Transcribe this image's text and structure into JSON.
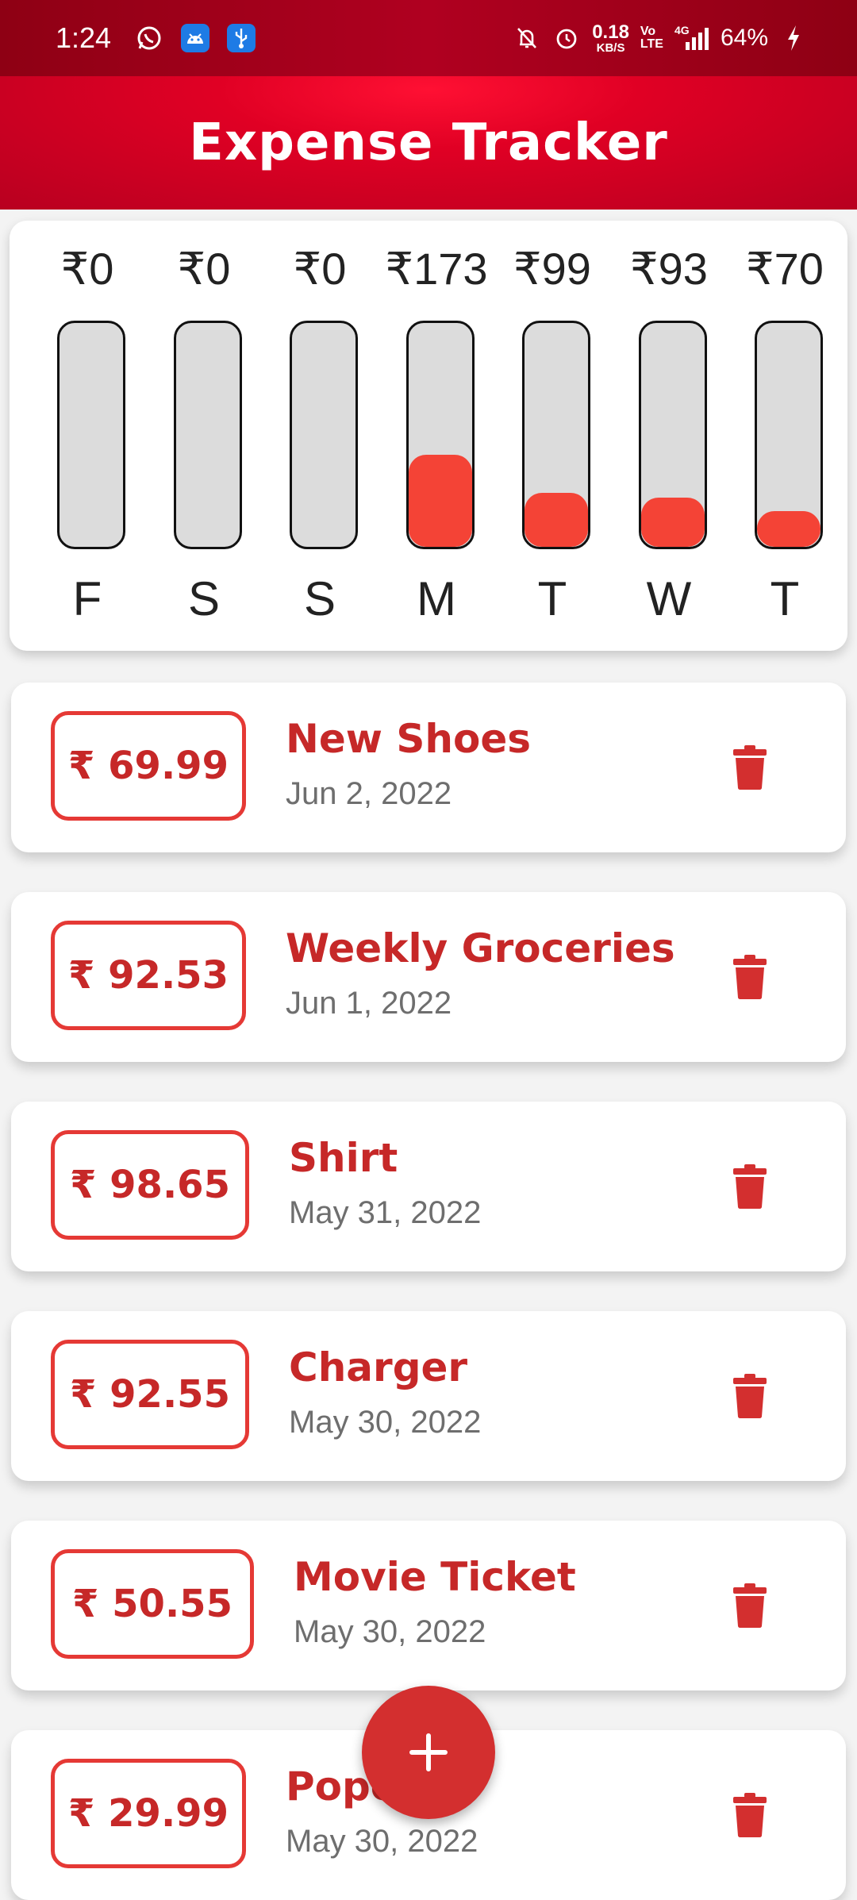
{
  "status_bar": {
    "time": "1:24",
    "net_speed_value": "0.18",
    "net_speed_unit": "KB/S",
    "volte_top": "Vo",
    "volte_bottom": "LTE",
    "network": "4G",
    "battery": "64%",
    "icons": [
      "whatsapp-icon",
      "android-icon",
      "usb-icon",
      "mute-icon",
      "alarm-icon",
      "signal-icon",
      "charging-icon"
    ]
  },
  "app_bar": {
    "title": "Expense Tracker"
  },
  "chart_data": {
    "type": "bar",
    "categories": [
      "F",
      "S",
      "S",
      "M",
      "T",
      "W",
      "T"
    ],
    "labels": [
      "₹0",
      "₹0",
      "₹0",
      "₹173",
      "₹99",
      "₹93",
      "₹70"
    ],
    "values": [
      0,
      0,
      0,
      173,
      99,
      93,
      70
    ],
    "fill_fraction": [
      0,
      0,
      0,
      0.41,
      0.24,
      0.22,
      0.16
    ]
  },
  "transactions": [
    {
      "amount": "₹ 69.99",
      "title": "New Shoes",
      "date": "Jun 2, 2022"
    },
    {
      "amount": "₹ 92.53",
      "title": "Weekly Groceries",
      "date": "Jun 1, 2022"
    },
    {
      "amount": "₹ 98.65",
      "title": "Shirt",
      "date": "May 31, 2022"
    },
    {
      "amount": "₹ 92.55",
      "title": "Charger",
      "date": "May 30, 2022"
    },
    {
      "amount": "₹ 50.55",
      "title": "Movie Ticket",
      "date": "May 30, 2022"
    },
    {
      "amount": "₹ 29.99",
      "title": "Popc",
      "date": "May 30, 2022"
    }
  ],
  "fab": {
    "label": "+"
  },
  "colors": {
    "primary": "#d50022",
    "accent": "#f44336",
    "text_red": "#c62828",
    "bar_track": "#dcdcdc"
  }
}
